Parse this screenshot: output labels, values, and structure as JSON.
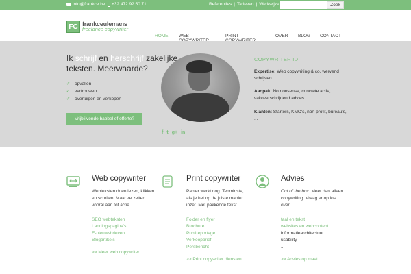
{
  "topbar": {
    "email": "info@frankce.be",
    "phone": "+32 472 92 50 71",
    "links": [
      "Referenties",
      "Tarieven",
      "Werkwijze"
    ],
    "search_placeholder": "",
    "search_button": "Zoek",
    "accent": "#7dbf7d"
  },
  "header": {
    "logo_mark": "FC",
    "logo_name": "frankceulemans",
    "logo_sub": "freelance copywriter",
    "nav": [
      "HOME",
      "WEB COPYWRITER",
      "PRINT COPYWRITER",
      "OVER",
      "BLOG",
      "CONTACT"
    ],
    "active_nav": "HOME"
  },
  "hero": {
    "headline_1": "Ik",
    "headline_2": "schrijf",
    "headline_3": "en",
    "headline_4": "herschrijf",
    "headline_5": "zakelijke teksten. Meerwaarde?",
    "benefits": [
      "opvallen",
      "vertrouwen",
      "overtuigen en verkopen"
    ],
    "cta_label": "Vrijblijvende babbel of offerte?",
    "social_icons": [
      "facebook-icon",
      "twitter-icon",
      "googleplus-icon",
      "linkedin-icon"
    ],
    "social_glyphs": [
      "f",
      "t",
      "g+",
      "in"
    ],
    "id_title": "COPYWRITER ID",
    "expertise_label": "Expertise:",
    "expertise_text": "Web copywriting & co, wervend schrijven",
    "aanpak_label": "Aanpak:",
    "aanpak_text": "No nonsense, concrete actie, vakoverschrijdend advies.",
    "klanten_label": "Klanten:",
    "klanten_text": "Starters, KMO's, non-profit, bureau's, ..."
  },
  "columns": {
    "web": {
      "title": "Web copywriter",
      "desc": "Webteksten doen lezen, klikken en scrollen. Maar ze zetten vooral aan tot actie.",
      "links": [
        "SEO webteksten",
        "Landingspagina's",
        "E-nieuwsbrieven",
        "Blogartikels"
      ],
      "more": ">> Meer web copywriter"
    },
    "print": {
      "title": "Print copywriter",
      "desc": "Papier werkt nog. Tenminste, als je het op de juiste manier inzet. Met pakkende tekst",
      "links": [
        "Folder en flyer",
        "Brochure",
        "Publireportage",
        "Verkoopbrief",
        "Persbericht"
      ],
      "more": ">> Print copywriter diensten"
    },
    "advies": {
      "title": "Advies",
      "desc_em": "Out of the box.",
      "desc": "Meer dan alleen copywriting. Vraag er op los over ...",
      "links": [
        "taal en tekst",
        "websites en webcontent"
      ],
      "plain_links": [
        "informatiearchitectuur",
        "usability",
        "..."
      ],
      "more": ">> Advies op maat"
    }
  }
}
